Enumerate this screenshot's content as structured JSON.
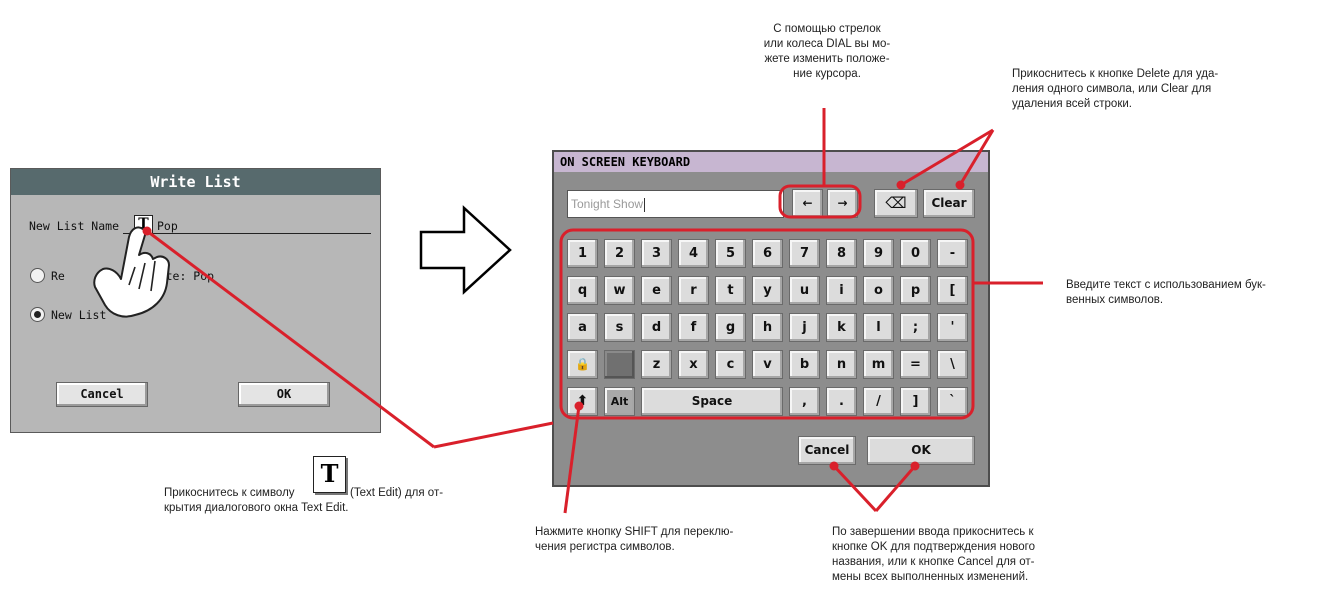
{
  "write_list": {
    "title": "Write List",
    "name_label": "New List Name",
    "t_icon": "T",
    "name_value": "Pop",
    "option_replace": "Replace Overwrite: Pop",
    "option_replace_left": "Re",
    "option_replace_right": "erwrite: Pop",
    "option_new": "New List",
    "cancel_label": "Cancel",
    "ok_label": "OK",
    "selected_option": "New List"
  },
  "keyboard": {
    "title": "ON SCREEN KEYBOARD",
    "input_value": "Tonight Show",
    "left_arrow": "←",
    "right_arrow": "→",
    "delete_glyph": "⌫",
    "clear_label": "Clear",
    "rows": [
      [
        "1",
        "2",
        "3",
        "4",
        "5",
        "6",
        "7",
        "8",
        "9",
        "0",
        "-"
      ],
      [
        "q",
        "w",
        "e",
        "r",
        "t",
        "y",
        "u",
        "i",
        "o",
        "p",
        "["
      ],
      [
        "a",
        "s",
        "d",
        "f",
        "g",
        "h",
        "j",
        "k",
        "l",
        ";",
        "'"
      ],
      [
        "🔒",
        "",
        "z",
        "x",
        "c",
        "v",
        "b",
        "n",
        "m",
        "=",
        "\\"
      ],
      [
        "⬆",
        "Alt",
        "Space",
        ",",
        ".",
        "/",
        "]",
        "`"
      ]
    ],
    "row3": [
      "a",
      "s",
      "d",
      "f",
      "g",
      "h",
      "j",
      "k",
      "l",
      ";",
      "'"
    ],
    "row4_letters": [
      "z",
      "x",
      "c",
      "v",
      "b",
      "n",
      "m",
      "=",
      "\\"
    ],
    "row5": {
      "shift": "🡅",
      "alt": "Alt",
      "space": "Space",
      "k1": ",",
      "k2": ".",
      "k3": "/",
      "k4": "]",
      "k5": "`"
    },
    "cancel_label": "Cancel",
    "ok_label": "OK"
  },
  "annotations": {
    "arrows": [
      "С помощью стрелок",
      "или колеса DIAL вы мо-",
      "жете изменить положе-",
      "ние курсора."
    ],
    "delete": [
      "Прикоснитесь к кнопке Delete для уда-",
      "ления одного символа, или Clear для",
      "удаления всей строки."
    ],
    "text_entry": [
      "Введите текст с использованием бук-",
      "венных символов."
    ],
    "text_edit_prefix": "Прикоснитесь к символу",
    "text_edit_suffix": "(Text Edit) для от-",
    "text_edit_line2": "крытия диалогового окна Text Edit.",
    "shift": [
      "Нажмите кнопку SHIFT для переклю-",
      "чения регистра символов."
    ],
    "ok_cancel": [
      "По завершении ввода прикоснитесь к",
      "кнопке OK для подтверждения нового",
      "названия, или к кнопке Cancel для от-",
      "мены всех выполненных изменений."
    ]
  },
  "colors": {
    "callout": "#d9202b",
    "dialog_bg": "#b7b7b7",
    "dialog_title": "#576a6d",
    "keyboard_bg": "#8d8d8d",
    "keyboard_title": "#c7b6d1"
  }
}
